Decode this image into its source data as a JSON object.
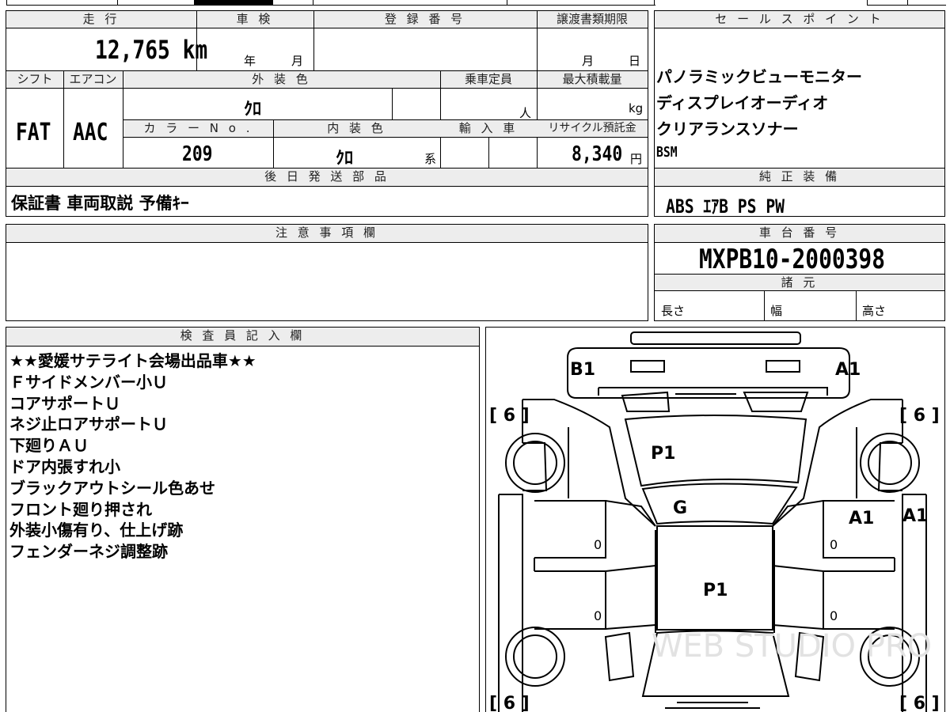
{
  "vehicle_info": {
    "headers": {
      "mileage": "走 行",
      "inspection": "車 検",
      "registration_no": "登 録 番 号",
      "transfer_deadline": "譲渡書類期限",
      "shift": "シフト",
      "aircon": "エアコン",
      "exterior_color": "外 装 色",
      "capacity": "乗車定員",
      "max_load": "最大積載量",
      "color_no": "カ ラ ー  N o .",
      "interior_color": "内 装 色",
      "import": "輸 入 車",
      "recycle_fee": "リサイクル預託金"
    },
    "mileage_value": "12,765",
    "mileage_unit": "km",
    "inspection_year_unit": "年",
    "inspection_month_unit": "月",
    "deadline_month_unit": "月",
    "deadline_day_unit": "日",
    "shift_value": "FAT",
    "aircon_value": "AAC",
    "exterior_color_value": "ｸﾛ",
    "capacity_unit": "人",
    "max_load_unit": "kg",
    "color_no_value": "209",
    "interior_color_value": "ｸﾛ",
    "interior_suffix": "系",
    "recycle_value": "8,340",
    "recycle_unit": "円"
  },
  "later_parts": {
    "header": "後 日 発 送 部 品",
    "value": "保証書 車両取説 予備ｷｰ"
  },
  "sales_points": {
    "header": "セ ー ル ス ポ イ ン ト",
    "items": [
      "パノラミックビューモニター",
      "ディスプレイオーディオ",
      "クリアランスソナー",
      "BSM"
    ]
  },
  "genuine_equipment": {
    "header": "純 正 装 備",
    "value": "ABS ｴｱB PS PW"
  },
  "caution": {
    "header": "注 意 事 項 欄"
  },
  "chassis": {
    "header": "車 台 番 号",
    "value": "MXPB10-2000398",
    "specs_header": "諸 元",
    "length_label": "長さ",
    "width_label": "幅",
    "height_label": "高さ"
  },
  "inspector": {
    "header": "検 査 員 記 入 欄",
    "notes": [
      "★★愛媛サテライト会場出品車★★",
      "Ｆサイドメンバー小Ｕ",
      "コアサポートＵ",
      "ネジ止ロアサポートＵ",
      "下廻りＡＵ",
      "ドア内張すれ小",
      "ブラックアウトシール色あせ",
      "フロント廻り押され",
      "外装小傷有り、仕上げ跡",
      "フェンダーネジ調整跡"
    ]
  },
  "diagram": {
    "marks": {
      "front_left": "B1",
      "front_right": "A1",
      "hood": "P1",
      "windshield": "G",
      "roof": "P1",
      "right_front_door": "A1",
      "right_side": "A1"
    },
    "tire_tl": "[ 6 ]",
    "tire_tr": "[ 6 ]",
    "tire_bl": "[ 6 ]",
    "tire_br": "[ 6 ]",
    "door_zero": "0",
    "watermark": "WEB STUDIO PRO"
  }
}
